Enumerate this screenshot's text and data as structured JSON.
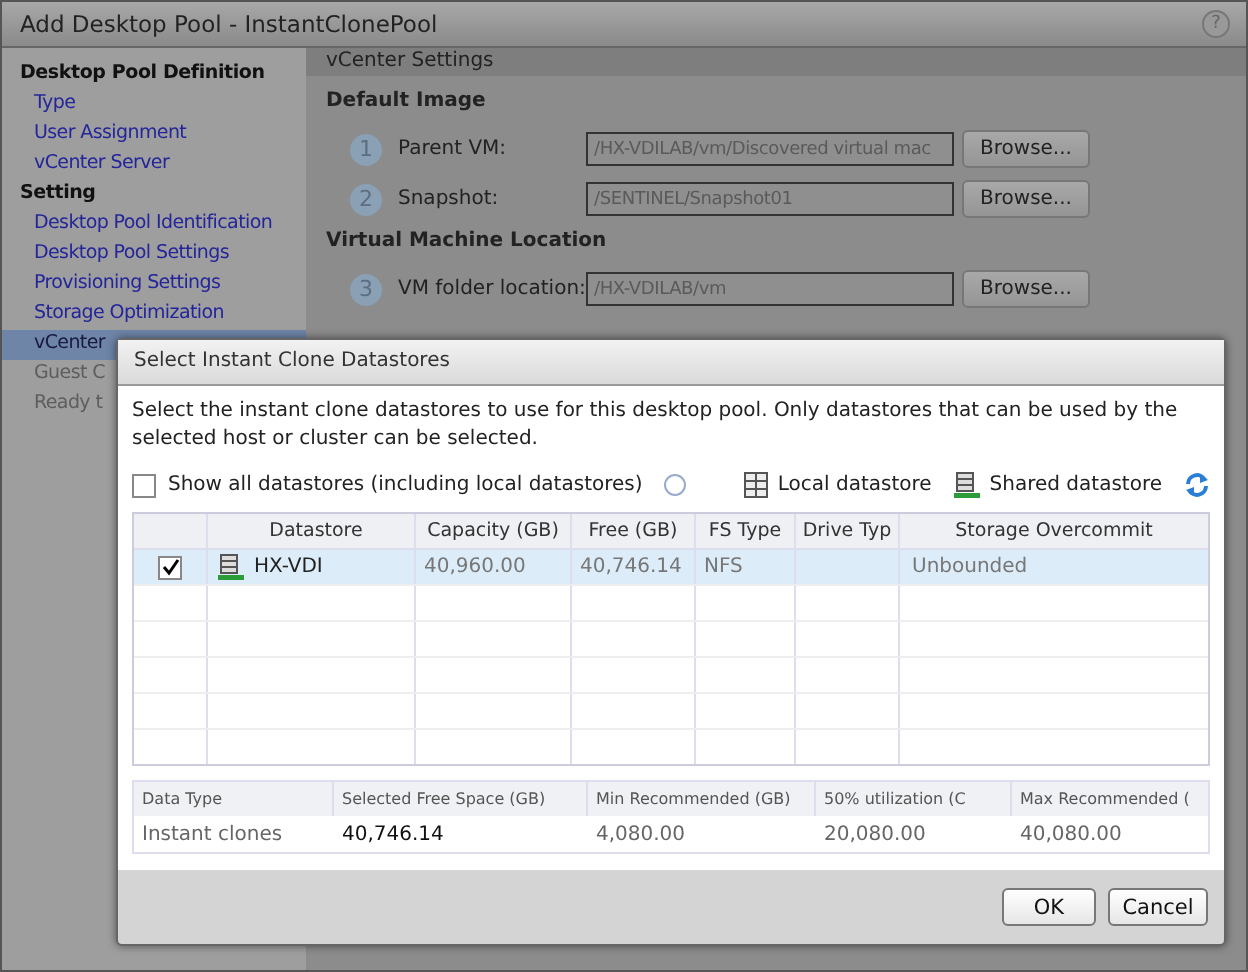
{
  "window": {
    "title": "Add Desktop Pool - InstantClonePool",
    "help": "?"
  },
  "sidebar": {
    "sections": [
      {
        "heading": "Desktop Pool Definition",
        "items": [
          {
            "label": "Type",
            "selected": false,
            "disabled": false
          },
          {
            "label": "User Assignment",
            "selected": false,
            "disabled": false
          },
          {
            "label": "vCenter Server",
            "selected": false,
            "disabled": false
          }
        ]
      },
      {
        "heading": "Setting",
        "items": [
          {
            "label": "Desktop Pool Identification",
            "selected": false,
            "disabled": false
          },
          {
            "label": "Desktop Pool Settings",
            "selected": false,
            "disabled": false
          },
          {
            "label": "Provisioning Settings",
            "selected": false,
            "disabled": false
          },
          {
            "label": "Storage Optimization",
            "selected": false,
            "disabled": false
          },
          {
            "label": "vCenter",
            "selected": true,
            "disabled": false
          },
          {
            "label": "Guest C",
            "selected": false,
            "disabled": true
          },
          {
            "label": "Ready t",
            "selected": false,
            "disabled": true
          }
        ]
      }
    ]
  },
  "panel": {
    "header": "vCenter Settings",
    "sections": [
      {
        "heading": "Default Image",
        "fields": [
          {
            "step": "1",
            "label": "Parent VM:",
            "value": "/HX-VDILAB/vm/Discovered virtual mac",
            "button": "Browse..."
          },
          {
            "step": "2",
            "label": "Snapshot:",
            "value": "/SENTINEL/Snapshot01",
            "button": "Browse..."
          }
        ]
      },
      {
        "heading": "Virtual Machine Location",
        "fields": [
          {
            "step": "3",
            "label": "VM folder location:",
            "value": "/HX-VDILAB/vm",
            "button": "Browse..."
          }
        ]
      }
    ]
  },
  "dialog": {
    "title": "Select Instant Clone Datastores",
    "description": "Select the instant clone datastores to use for this desktop pool. Only datastores that can be used by the selected host or cluster can be selected.",
    "show_all": {
      "label": "Show all datastores (including local datastores)",
      "checked": false
    },
    "legend": [
      "Local datastore",
      "Shared datastore"
    ],
    "table": {
      "columns": [
        "Datastore",
        "Capacity (GB)",
        "Free (GB)",
        "FS Type",
        "Drive Typ",
        "Storage Overcommit"
      ],
      "rows": [
        {
          "selected": true,
          "checked": true,
          "datastore": "HX-VDI",
          "capacity": "40,960.00",
          "free": "40,746.14",
          "fs_type": "NFS",
          "overcommit": "Unbounded"
        }
      ]
    },
    "summary": {
      "columns": [
        "Data Type",
        "Selected Free Space (GB)",
        "Min Recommended (GB)",
        "50% utilization (C",
        "Max Recommended ("
      ],
      "rows": [
        [
          "Instant clones",
          "40,746.14",
          "4,080.00",
          "20,080.00",
          "40,080.00"
        ]
      ]
    },
    "buttons": [
      "OK",
      "Cancel"
    ]
  }
}
